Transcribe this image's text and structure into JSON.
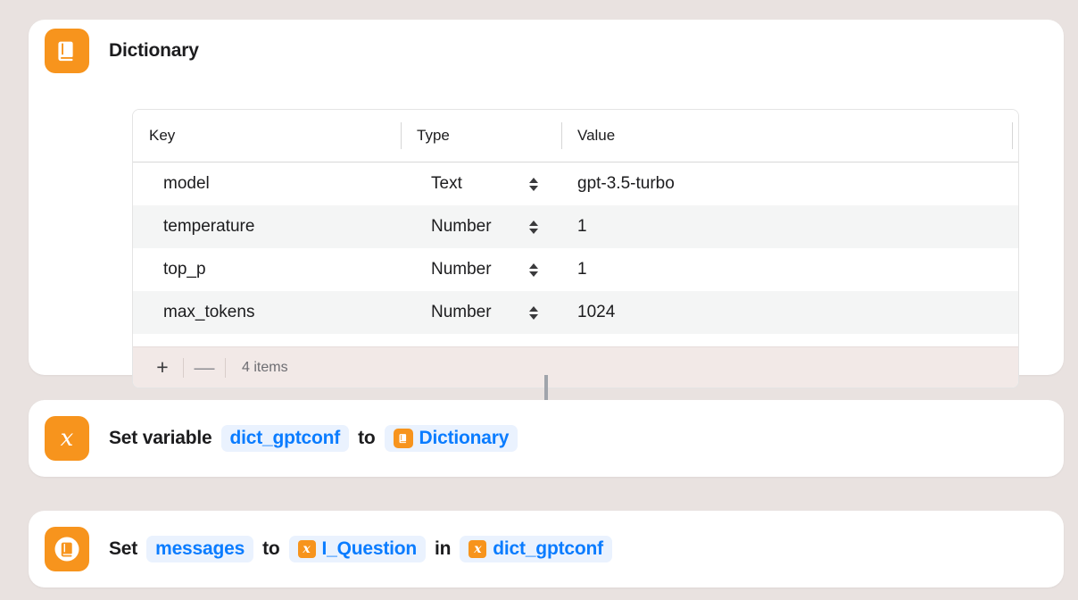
{
  "theme": {
    "background": "#e9e2e0",
    "card_background": "#ffffff",
    "accent_orange": "#f7941d",
    "link_blue": "#0a7cff",
    "pill_background": "#eaf2fe",
    "row_alt": "#f4f5f5",
    "footer_background": "#f2e9e7",
    "connector": "#a0a4ab"
  },
  "dictionary_card": {
    "icon": "dictionary-book-icon",
    "title": "Dictionary",
    "table": {
      "columns": [
        "Key",
        "Type",
        "Value"
      ],
      "rows": [
        {
          "key": "model",
          "type": "Text",
          "value": "gpt-3.5-turbo"
        },
        {
          "key": "temperature",
          "type": "Number",
          "value": "1"
        },
        {
          "key": "top_p",
          "type": "Number",
          "value": "1"
        },
        {
          "key": "max_tokens",
          "type": "Number",
          "value": "1024"
        }
      ]
    },
    "footer": {
      "add_label": "+",
      "remove_label": "—",
      "count_label": "4 items"
    }
  },
  "set_variable_card": {
    "icon": "variable-x-icon",
    "word_1": "Set variable",
    "variable_pill": "dict_gptconf",
    "word_2": "to",
    "value_pill": {
      "icon": "dictionary-book-icon",
      "label": "Dictionary"
    }
  },
  "set_dictionary_value_card": {
    "icon": "dictionary-book-circle-icon",
    "word_1": "Set",
    "key_pill": "messages",
    "word_2": "to",
    "value_pill": {
      "icon": "variable-x-icon",
      "label": "I_Question"
    },
    "word_3": "in",
    "target_pill": {
      "icon": "variable-x-icon",
      "label": "dict_gptconf"
    }
  }
}
